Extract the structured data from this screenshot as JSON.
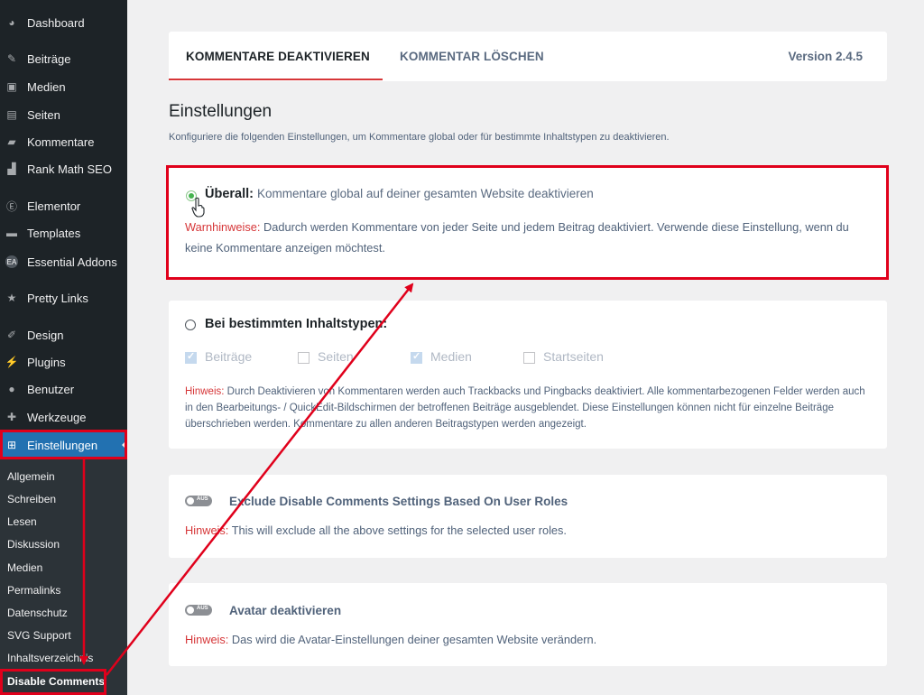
{
  "sidebar": {
    "items": [
      {
        "label": "Dashboard",
        "icon": "dashboard-icon"
      },
      {
        "label": "Beiträge",
        "icon": "pin-icon"
      },
      {
        "label": "Medien",
        "icon": "media-icon"
      },
      {
        "label": "Seiten",
        "icon": "pages-icon"
      },
      {
        "label": "Kommentare",
        "icon": "comment-icon"
      },
      {
        "label": "Rank Math SEO",
        "icon": "chart-icon"
      },
      {
        "label": "Elementor",
        "icon": "elementor-icon"
      },
      {
        "label": "Templates",
        "icon": "folder-icon"
      },
      {
        "label": "Essential Addons",
        "icon": "ea-icon"
      },
      {
        "label": "Pretty Links",
        "icon": "star-icon"
      },
      {
        "label": "Design",
        "icon": "brush-icon"
      },
      {
        "label": "Plugins",
        "icon": "plug-icon"
      },
      {
        "label": "Benutzer",
        "icon": "user-icon"
      },
      {
        "label": "Werkzeuge",
        "icon": "wrench-icon"
      },
      {
        "label": "Einstellungen",
        "icon": "settings-icon"
      }
    ],
    "submenu": [
      "Allgemein",
      "Schreiben",
      "Lesen",
      "Diskussion",
      "Medien",
      "Permalinks",
      "Datenschutz",
      "SVG Support",
      "Inhaltsverzeichnis",
      "Disable Comments"
    ]
  },
  "tabs": {
    "tab1": "KOMMENTARE DEAKTIVIEREN",
    "tab2": "KOMMENTAR LÖSCHEN",
    "version": "Version 2.4.5"
  },
  "settings": {
    "title": "Einstellungen",
    "description": "Konfiguriere die folgenden Einstellungen, um Kommentare global oder für bestimmte Inhaltstypen zu deaktivieren."
  },
  "everywhere": {
    "title": "Überall:",
    "desc": "Kommentare global auf deiner gesamten Website deaktivieren",
    "warn_label": "Warnhinweise:",
    "warn_text": "Dadurch werden Kommentare von jeder Seite und jedem Beitrag deaktiviert. Verwende diese Einstellung, wenn du keine Kommentare anzeigen möchtest."
  },
  "specific": {
    "title": "Bei bestimmten Inhaltstypen:",
    "types": [
      {
        "label": "Beiträge",
        "checked": true
      },
      {
        "label": "Seiten",
        "checked": false
      },
      {
        "label": "Medien",
        "checked": true
      },
      {
        "label": "Startseiten",
        "checked": false
      }
    ],
    "hint_label": "Hinweis:",
    "hint_text": "Durch Deaktivieren von Kommentaren werden auch Trackbacks und Pingbacks deaktiviert. Alle kommentarbezogenen Felder werden auch in den Bearbeitungs- / QuickEdit-Bildschirmen der betroffenen Beiträge ausgeblendet. Diese Einstellungen können nicht für einzelne Beiträge überschrieben werden. Kommentare zu allen anderen Beitragstypen werden angezeigt."
  },
  "exclude": {
    "toggle": "AUS",
    "title": "Exclude Disable Comments Settings Based On User Roles",
    "hint_label": "Hinweis:",
    "hint_text": "This will exclude all the above settings for the selected user roles."
  },
  "avatar": {
    "toggle": "AUS",
    "title": "Avatar deaktivieren",
    "hint_label": "Hinweis:",
    "hint_text": "Das wird die Avatar-Einstellungen deiner gesamten Website verändern."
  },
  "colors": {
    "accent": "#2271b1",
    "highlight": "#e0001b",
    "warning": "#d63638"
  }
}
